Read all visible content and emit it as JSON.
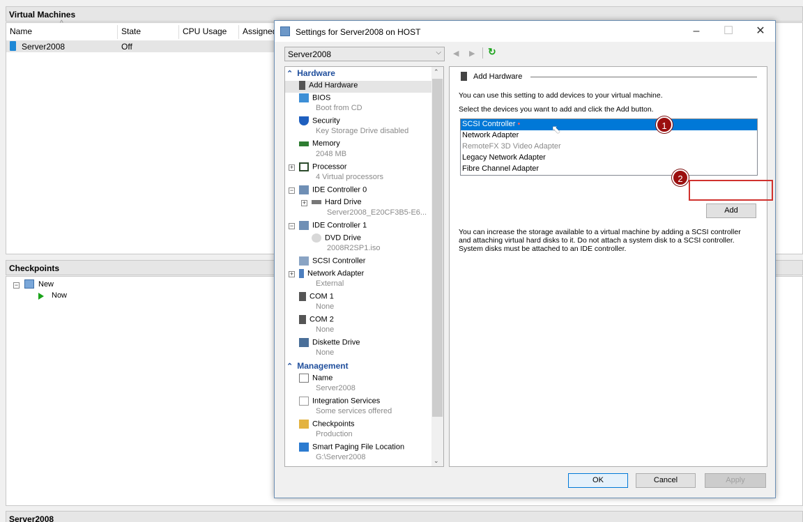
{
  "vm_panel": {
    "title": "Virtual Machines",
    "columns": [
      "Name",
      "State",
      "CPU Usage",
      "Assigned"
    ],
    "rows": [
      {
        "name": "Server2008",
        "state": "Off"
      }
    ]
  },
  "checkpoints_panel": {
    "title": "Checkpoints",
    "tree": [
      "New",
      "Now"
    ]
  },
  "bottom_panel": {
    "title": "Server2008"
  },
  "dialog": {
    "title": "Settings for Server2008 on HOST",
    "vm_selector": "Server2008",
    "hardware_section": "Hardware",
    "management_section": "Management",
    "tree_items": [
      {
        "label": "Add Hardware",
        "sub": ""
      },
      {
        "label": "BIOS",
        "sub": "Boot from CD"
      },
      {
        "label": "Security",
        "sub": "Key Storage Drive disabled"
      },
      {
        "label": "Memory",
        "sub": "2048 MB"
      },
      {
        "label": "Processor",
        "sub": "4 Virtual processors"
      },
      {
        "label": "IDE Controller 0",
        "sub": ""
      },
      {
        "label": "Hard Drive",
        "sub": "Server2008_E20CF3B5-E6..."
      },
      {
        "label": "IDE Controller 1",
        "sub": ""
      },
      {
        "label": "DVD Drive",
        "sub": "2008R2SP1.iso"
      },
      {
        "label": "SCSI Controller",
        "sub": ""
      },
      {
        "label": "Network Adapter",
        "sub": "External"
      },
      {
        "label": "COM 1",
        "sub": "None"
      },
      {
        "label": "COM 2",
        "sub": "None"
      },
      {
        "label": "Diskette Drive",
        "sub": "None"
      }
    ],
    "management_items": [
      {
        "label": "Name",
        "sub": "Server2008"
      },
      {
        "label": "Integration Services",
        "sub": "Some services offered"
      },
      {
        "label": "Checkpoints",
        "sub": "Production"
      },
      {
        "label": "Smart Paging File Location",
        "sub": "G:\\Server2008"
      }
    ],
    "add_hardware": {
      "heading": "Add Hardware",
      "intro": "You can use this setting to add devices to your virtual machine.",
      "instruction": "Select the devices you want to add and click the Add button.",
      "devices": [
        "SCSI Controller",
        "Network Adapter",
        "RemoteFX 3D Video Adapter",
        "Legacy Network Adapter",
        "Fibre Channel Adapter"
      ],
      "selected_device": "SCSI Controller",
      "add_label": "Add",
      "note": "You can increase the storage available to a virtual machine by adding a SCSI controller and attaching virtual hard disks to it. Do not attach a system disk to a SCSI controller. System disks must be attached to an IDE controller."
    },
    "buttons": {
      "ok": "OK",
      "cancel": "Cancel",
      "apply": "Apply"
    }
  },
  "annotations": {
    "step1": "1",
    "step2": "2"
  },
  "colors": {
    "accent": "#0078d7",
    "section": "#1f4e9c",
    "badge": "#9b0f0f",
    "highlight_box": "#d0312d"
  }
}
